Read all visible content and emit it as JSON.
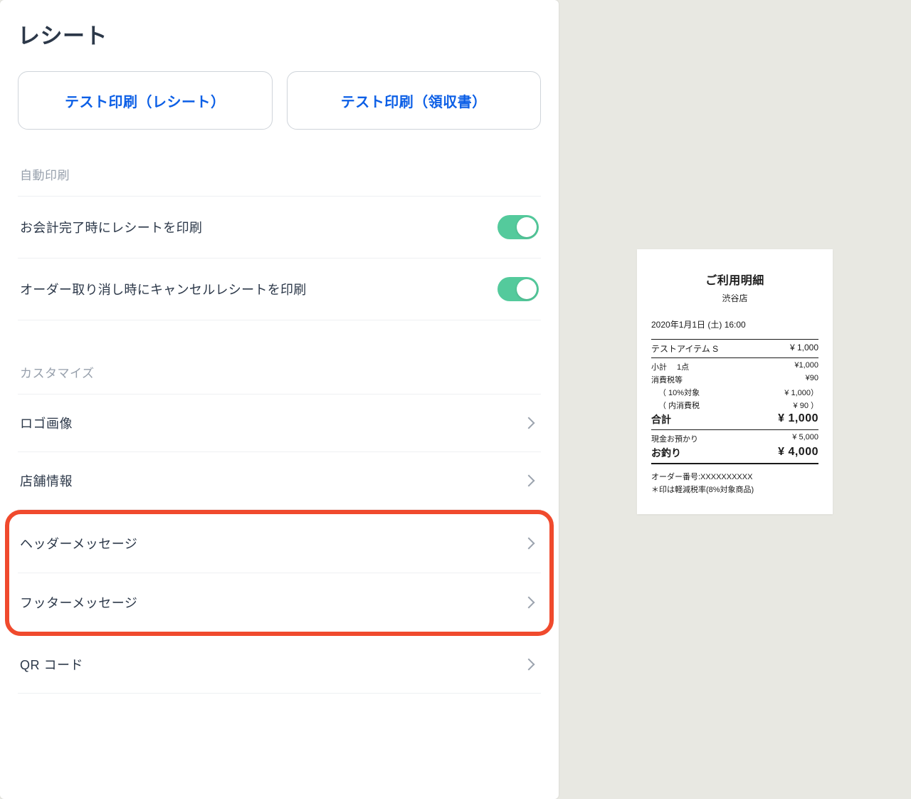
{
  "page": {
    "title": "レシート"
  },
  "buttons": {
    "test_print_receipt": "テスト印刷（レシート）",
    "test_print_invoice": "テスト印刷（領収書）"
  },
  "sections": {
    "auto_print": "自動印刷",
    "customize": "カスタマイズ"
  },
  "toggles": {
    "print_on_checkout": {
      "label": "お会計完了時にレシートを印刷",
      "on": true
    },
    "print_on_cancel": {
      "label": "オーダー取り消し時にキャンセルレシートを印刷",
      "on": true
    }
  },
  "nav": {
    "logo": "ロゴ画像",
    "store_info": "店舗情報",
    "header_msg": "ヘッダーメッセージ",
    "footer_msg": "フッターメッセージ",
    "qr_code": "QR コード"
  },
  "receipt": {
    "title": "ご利用明細",
    "store": "渋谷店",
    "date": "2020年1月1日 (土) 16:00",
    "item_name": "テストアイテム S",
    "item_price": "¥ 1,000",
    "subtotal_label": "小計  1点",
    "subtotal_value": "¥1,000",
    "tax_label": "消費税等",
    "tax_value": "¥90",
    "tax_target_label": "（ 10%対象",
    "tax_target_value": "¥ 1,000）",
    "inner_tax_label": "（ 内消費税",
    "inner_tax_value": "¥ 90 ）",
    "total_label": "合計",
    "total_value": "¥ 1,000",
    "paid_label": "現金お預かり",
    "paid_value": "¥ 5,000",
    "change_label": "お釣り",
    "change_value": "¥ 4,000",
    "order_no": "オーダー番号:XXXXXXXXXX",
    "tax_note": "＊印は軽減税率(8%対象商品)"
  }
}
